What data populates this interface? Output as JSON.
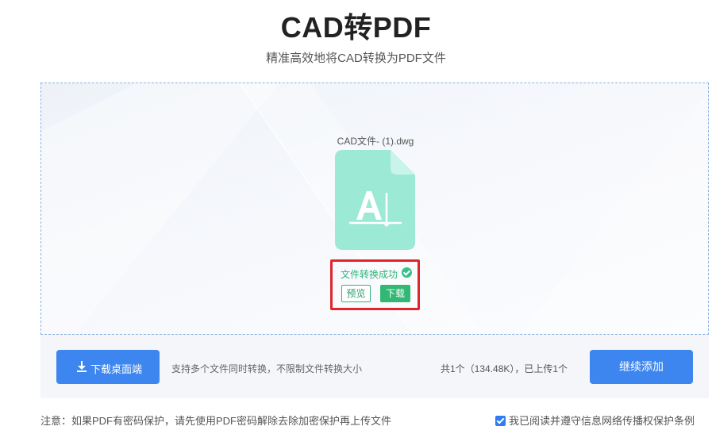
{
  "header": {
    "title": "CAD转PDF",
    "subtitle": "精准高效地将CAD转换为PDF文件"
  },
  "file": {
    "name": "CAD文件- (1).dwg",
    "icon": "cad-file-icon",
    "icon_color": "#9ce9d6",
    "status": "文件转换成功",
    "preview_label": "预览",
    "download_label": "下载"
  },
  "action_bar": {
    "desktop_download_label": "下载桌面端",
    "hint": "支持多个文件同时转换，不限制文件转换大小",
    "summary": "共1个（134.48K），已上传1个",
    "continue_label": "继续添加"
  },
  "footer": {
    "notice": "注意：如果PDF有密码保护，请先使用PDF密码解除去除加密保护再上传文件",
    "agree_label": "我已阅读并遵守信息网络传播权保护条例",
    "agree_checked": true
  },
  "colors": {
    "accent": "#3e86ef",
    "success": "#30b874",
    "highlight": "#e0262b"
  }
}
